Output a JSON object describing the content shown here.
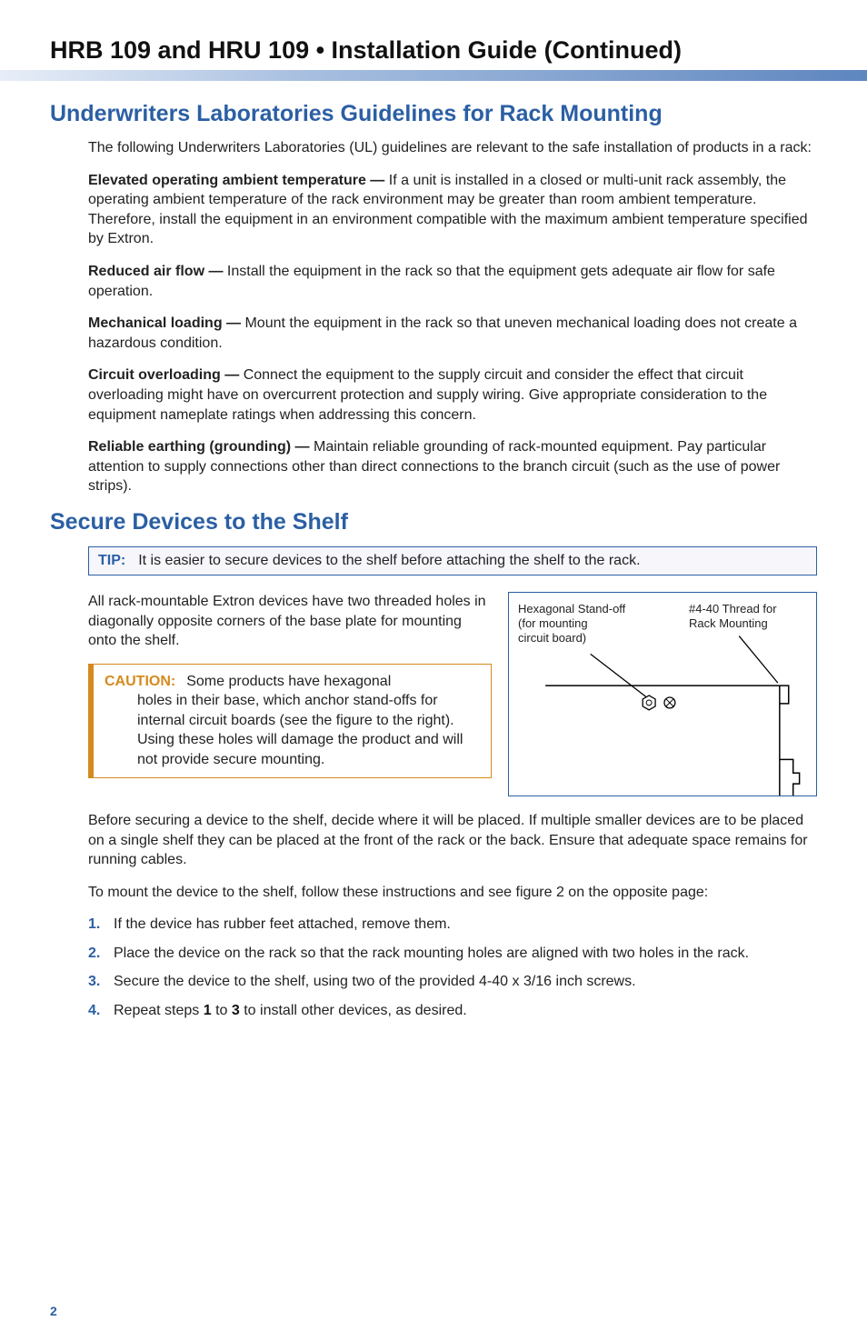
{
  "doc_title": "HRB 109 and HRU 109 • Installation Guide (Continued)",
  "section1": {
    "heading": "Underwriters Laboratories Guidelines for Rack Mounting",
    "intro": "The following Underwriters Laboratories (UL) guidelines are relevant to the safe installation of products in a rack:",
    "items": [
      {
        "term": "Elevated operating ambient temperature —",
        "text": " If a unit is installed in a closed or multi-unit rack assembly, the operating ambient temperature of the rack environment may be greater than room ambient temperature. Therefore, install the equipment in an environment compatible with the maximum ambient temperature specified by Extron."
      },
      {
        "term": "Reduced air flow —",
        "text": " Install the equipment in the rack so that the equipment gets adequate air flow for safe operation."
      },
      {
        "term": "Mechanical loading —",
        "text": " Mount the equipment in the rack so that uneven mechanical loading does not create a hazardous condition."
      },
      {
        "term": "Circuit overloading —",
        "text": " Connect the equipment to the supply circuit and consider the effect that circuit overloading might have on overcurrent protection and supply wiring. Give appropriate consideration to the equipment nameplate ratings when addressing this concern."
      },
      {
        "term": "Reliable earthing (grounding) —",
        "text": " Maintain reliable grounding of rack-mounted equipment. Pay particular attention to supply connections other than direct connections to the branch circuit (such as the use of power strips)."
      }
    ]
  },
  "section2": {
    "heading": "Secure Devices to the Shelf",
    "tip_label": "TIP:",
    "tip_text": "It is easier to secure devices to the shelf before attaching the shelf to the rack.",
    "para1": "All rack-mountable Extron devices have two threaded holes in diagonally opposite corners of the base plate for mounting onto the shelf.",
    "caution_label": "CAUTION:",
    "caution_lead": "Some products have hexagonal",
    "caution_rest": "holes in their base, which anchor stand-offs for internal circuit boards (see the figure to the right). Using these holes will damage the product and will not provide secure mounting.",
    "diagram": {
      "left_label_l1": "Hexagonal Stand-off",
      "left_label_l2": "(for mounting",
      "left_label_l3": "circuit board)",
      "right_label_l1": "#4-40 Thread for",
      "right_label_l2": "Rack Mounting"
    },
    "para2": "Before securing a device to the shelf, decide where it will be placed. If multiple smaller devices are to be placed on a single shelf they can be placed at the front of the rack or the back. Ensure that adequate space remains for running cables.",
    "para3": "To mount the device to the shelf, follow these instructions and see figure 2 on the opposite page:",
    "steps": [
      {
        "num": "1.",
        "text": "If the device has rubber feet attached, remove them."
      },
      {
        "num": "2.",
        "text": "Place the device on the rack so that the rack mounting holes are aligned with two holes in the rack."
      },
      {
        "num": "3.",
        "text": "Secure the device to the shelf, using two of the provided 4-40 x 3/16 inch screws."
      },
      {
        "num": "4.",
        "pre": "Repeat steps ",
        "b1": "1",
        "mid": " to ",
        "b2": "3",
        "post": " to install other devices, as desired."
      }
    ]
  },
  "page_number": "2"
}
